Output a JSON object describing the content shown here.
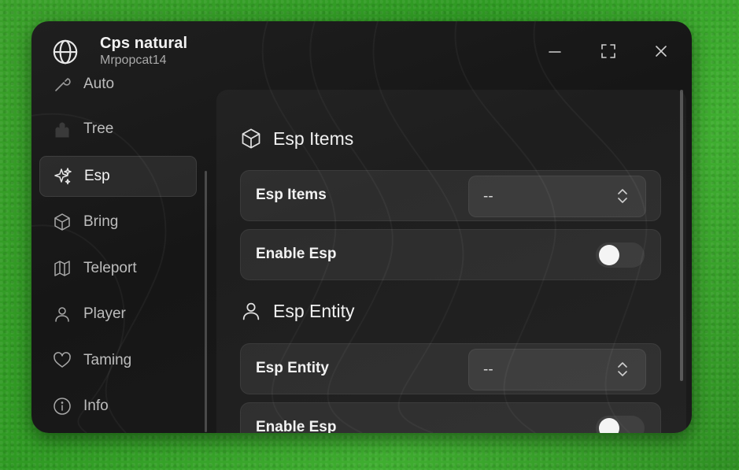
{
  "window": {
    "title": "Cps natural",
    "subtitle": "Mrpopcat14"
  },
  "sidebar": {
    "items": [
      {
        "label": "Auto",
        "icon": "auto-icon"
      },
      {
        "label": "Tree",
        "icon": "tree-icon"
      },
      {
        "label": "Esp",
        "icon": "sparkles-icon",
        "active": true
      },
      {
        "label": "Bring",
        "icon": "box-icon"
      },
      {
        "label": "Teleport",
        "icon": "map-icon"
      },
      {
        "label": "Player",
        "icon": "user-icon"
      },
      {
        "label": "Taming",
        "icon": "heart-icon"
      },
      {
        "label": "Info",
        "icon": "info-icon"
      }
    ]
  },
  "main": {
    "sections": [
      {
        "title": "Esp Items",
        "icon": "box-icon",
        "dropdown_label": "Esp Items",
        "dropdown_value": "--",
        "toggle_label": "Enable Esp",
        "toggle_on": false
      },
      {
        "title": "Esp Entity",
        "icon": "user-icon",
        "dropdown_label": "Esp Entity",
        "dropdown_value": "--",
        "toggle_label": "Enable Esp",
        "toggle_on": false
      }
    ]
  },
  "colors": {
    "background": "#34a026",
    "window": "#1a1a1a",
    "text": "#f2f2f2",
    "muted": "#bdbdbd"
  }
}
